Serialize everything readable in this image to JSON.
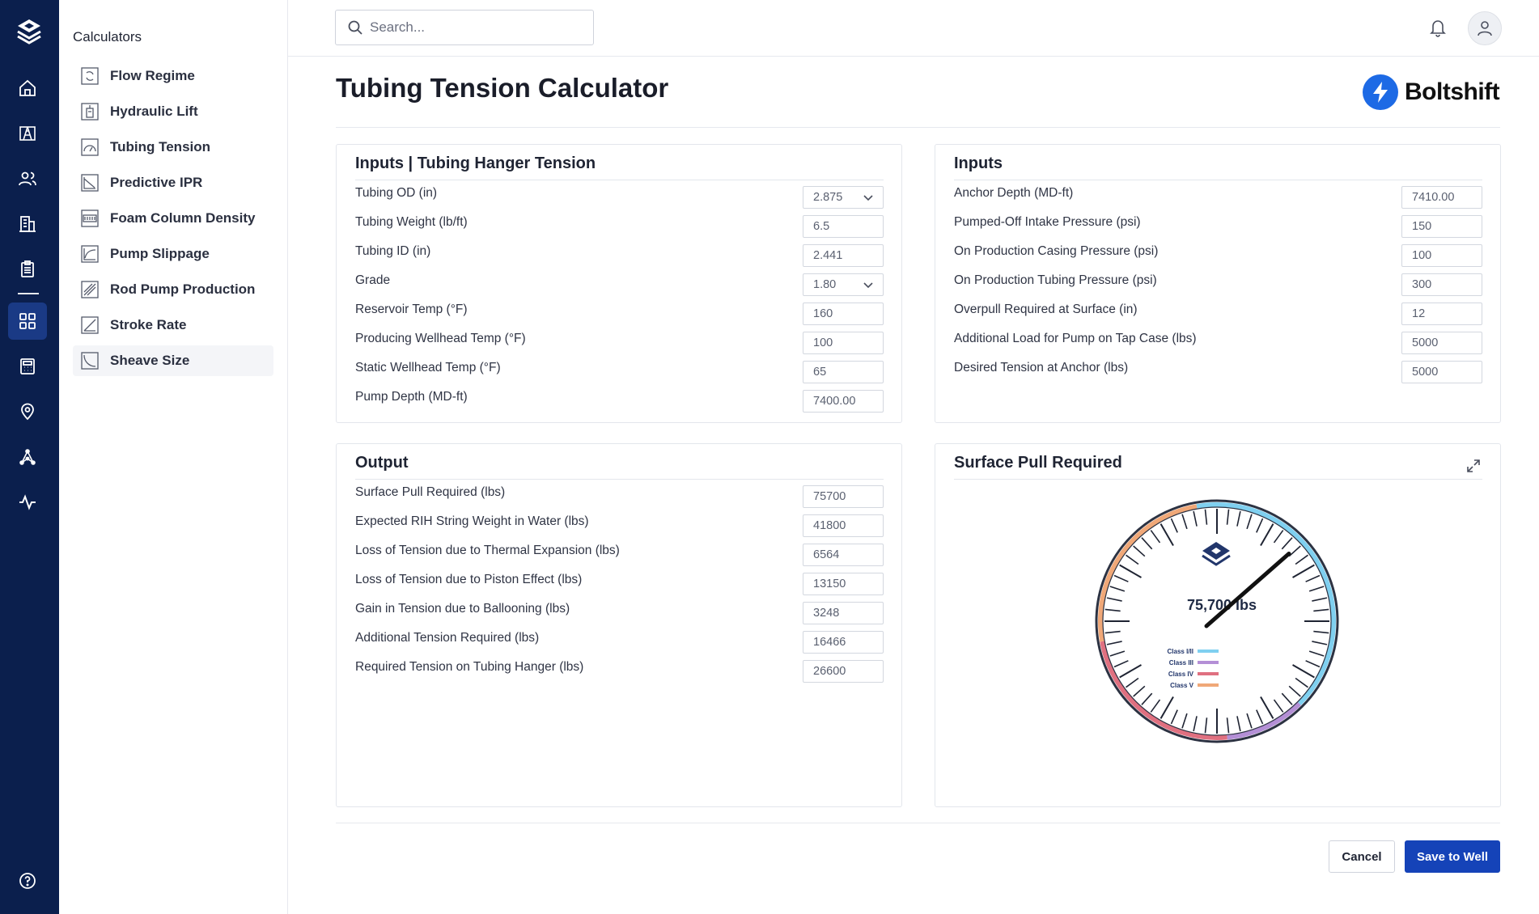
{
  "rail": {
    "items": [
      "home-icon",
      "oil-rig-icon",
      "users-icon",
      "building-icon",
      "clipboard-icon",
      "grid-icon",
      "calculator-icon",
      "location-pin-icon",
      "network-icon",
      "activity-icon",
      "help-icon"
    ],
    "active": "grid-icon"
  },
  "sidebar": {
    "title": "Calculators",
    "items": [
      {
        "label": "Flow Regime"
      },
      {
        "label": "Hydraulic Lift"
      },
      {
        "label": "Tubing Tension"
      },
      {
        "label": "Predictive IPR"
      },
      {
        "label": "Foam Column Density"
      },
      {
        "label": "Pump Slippage"
      },
      {
        "label": "Rod Pump Production"
      },
      {
        "label": "Stroke Rate"
      },
      {
        "label": "Sheave Size"
      }
    ],
    "active_index": 8
  },
  "topbar": {
    "search_placeholder": "Search..."
  },
  "page": {
    "title": "Tubing Tension Calculator",
    "brand_name": "Boltshift"
  },
  "hanger_card": {
    "title": "Inputs | Tubing Hanger Tension",
    "rows": [
      {
        "label": "Tubing OD (in)",
        "value": "2.875",
        "dropdown": true
      },
      {
        "label": "Tubing Weight (lb/ft)",
        "value": "6.5"
      },
      {
        "label": "Tubing ID (in)",
        "value": "2.441"
      },
      {
        "label": "Grade",
        "value": "1.80",
        "dropdown": true
      },
      {
        "label": "Reservoir Temp (°F)",
        "value": "160"
      },
      {
        "label": "Producing Wellhead Temp (°F)",
        "value": "100"
      },
      {
        "label": "Static Wellhead Temp (°F)",
        "value": "65"
      },
      {
        "label": "Pump Depth (MD-ft)",
        "value": "7400.00"
      }
    ]
  },
  "inputs_card": {
    "title": "Inputs",
    "rows": [
      {
        "label": "Anchor Depth (MD-ft)",
        "value": "7410.00"
      },
      {
        "label": "Pumped-Off Intake Pressure (psi)",
        "value": "150"
      },
      {
        "label": "On Production Casing Pressure (psi)",
        "value": "100"
      },
      {
        "label": "On Production Tubing Pressure (psi)",
        "value": "300"
      },
      {
        "label": "Overpull Required at Surface (in)",
        "value": "12"
      },
      {
        "label": "Additional Load for Pump on Tap Case (lbs)",
        "value": "5000"
      },
      {
        "label": "Desired Tension at Anchor (lbs)",
        "value": "5000"
      }
    ]
  },
  "output_card": {
    "title": "Output",
    "rows": [
      {
        "label": "Surface Pull Required (lbs)",
        "value": "75700"
      },
      {
        "label": "Expected RIH String Weight in Water (lbs)",
        "value": "41800"
      },
      {
        "label": "Loss of Tension due to Thermal Expansion (lbs)",
        "value": "6564"
      },
      {
        "label": "Loss of Tension due to Piston Effect (lbs)",
        "value": "13150"
      },
      {
        "label": "Gain in Tension due to Ballooning (lbs)",
        "value": "3248"
      },
      {
        "label": "Additional Tension Required (lbs)",
        "value": "16466"
      },
      {
        "label": "Required Tension on Tubing Hanger (lbs)",
        "value": "26600"
      }
    ]
  },
  "gauge_card": {
    "title": "Surface Pull Required",
    "readout": "75,700 lbs",
    "needle_fraction": 0.38,
    "legend": [
      {
        "label": "Class I/II",
        "color": "#7fd0f0"
      },
      {
        "label": "Class III",
        "color": "#b48fd6"
      },
      {
        "label": "Class IV",
        "color": "#e07080"
      },
      {
        "label": "Class V",
        "color": "#f0a878"
      }
    ]
  },
  "actions": {
    "cancel_label": "Cancel",
    "save_label": "Save to Well"
  },
  "colors": {
    "rail_bg": "#0b1f4d",
    "rail_active": "#1a3a85",
    "primary": "#1543b8",
    "brand_blue": "#1d6ae5"
  }
}
